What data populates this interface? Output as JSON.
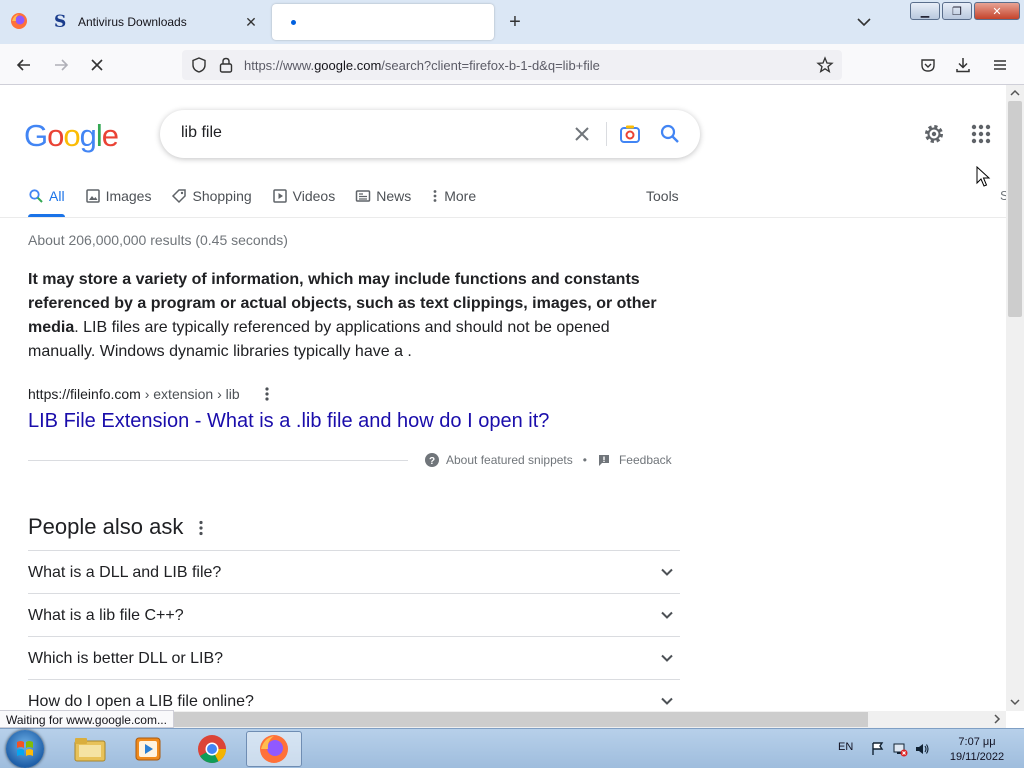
{
  "browser": {
    "tabs": [
      {
        "title": "Antivirus Downloads",
        "favicon": "S"
      },
      {
        "title": "",
        "loading": true
      }
    ],
    "url": {
      "prefix": "https://www.",
      "domain": "google.com",
      "rest": "/search?client=firefox-b-1-d&q=lib+file"
    },
    "status": "Waiting for www.google.com..."
  },
  "google": {
    "logo": [
      "G",
      "o",
      "o",
      "g",
      "l",
      "e"
    ],
    "logo_colors": [
      "#4285f4",
      "#ea4335",
      "#fbbc05",
      "#4285f4",
      "#34a853",
      "#ea4335"
    ],
    "query": "lib file",
    "tabs": [
      "All",
      "Images",
      "Shopping",
      "Videos",
      "News",
      "More"
    ],
    "tools": "Tools",
    "clipped_letter": "S",
    "stats": "About 206,000,000 results (0.45 seconds)",
    "snippet": {
      "bold": "It may store a variety of information, which may include functions and constants referenced by a program or actual objects, such as text clippings, images, or other media",
      "rest": ". LIB files are typically referenced by applications and should not be opened manually. Windows dynamic libraries typically have a ."
    },
    "result": {
      "site": "https://fileinfo.com",
      "path": " › extension › lib",
      "title": "LIB File Extension - What is a .lib file and how do I open it?"
    },
    "about_snippets": "About featured snippets",
    "separator": "•",
    "feedback": "Feedback",
    "paa_title": "People also ask",
    "paa": [
      "What is a DLL and LIB file?",
      "What is a lib file C++?",
      "Which is better DLL or LIB?",
      "How do I open a LIB file online?"
    ]
  },
  "taskbar": {
    "lang": "EN",
    "time": "7:07 μμ",
    "date": "19/11/2022"
  },
  "colors": {
    "accent": "#1a73e8",
    "link": "#1a0dab"
  }
}
